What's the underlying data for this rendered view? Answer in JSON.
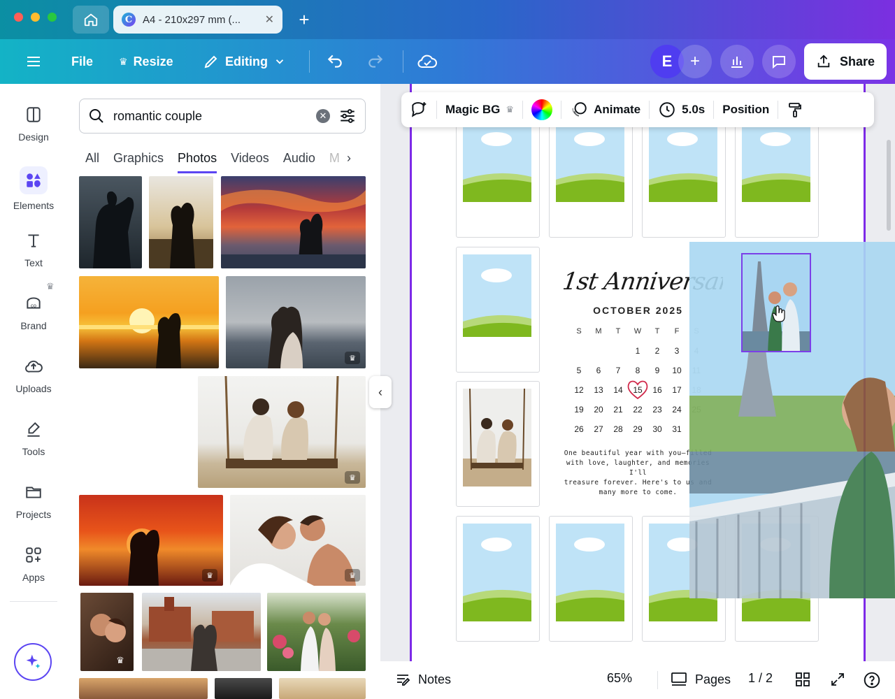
{
  "browser": {
    "tab_title": "A4 - 210x297 mm (...",
    "new_tab": "+"
  },
  "toolbar": {
    "file": "File",
    "resize": "Resize",
    "editing": "Editing",
    "avatar_initial": "E",
    "share": "Share"
  },
  "rail": {
    "items": [
      {
        "label": "Design",
        "icon": "layout-icon"
      },
      {
        "label": "Elements",
        "icon": "shapes-icon"
      },
      {
        "label": "Text",
        "icon": "text-icon"
      },
      {
        "label": "Brand",
        "icon": "brand-icon"
      },
      {
        "label": "Uploads",
        "icon": "cloud-upload-icon"
      },
      {
        "label": "Tools",
        "icon": "pen-icon"
      },
      {
        "label": "Projects",
        "icon": "folder-icon"
      },
      {
        "label": "Apps",
        "icon": "apps-icon"
      }
    ]
  },
  "panel": {
    "search_value": "romantic couple",
    "tabs": [
      "All",
      "Graphics",
      "Photos",
      "Videos",
      "Audio",
      "M"
    ],
    "active_tab": "Photos"
  },
  "context": {
    "magic_bg": "Magic BG",
    "animate": "Animate",
    "duration": "5.0s",
    "position": "Position"
  },
  "calendar": {
    "heading_script": "1st Anniversary",
    "month": "OCTOBER 2025",
    "dow": [
      "S",
      "M",
      "T",
      "W",
      "T",
      "F",
      "S"
    ],
    "days": [
      "",
      "",
      "",
      "1",
      "2",
      "3",
      "4",
      "5",
      "6",
      "7",
      "8",
      "9",
      "10",
      "11",
      "12",
      "13",
      "14",
      "15",
      "16",
      "17",
      "18",
      "19",
      "20",
      "21",
      "22",
      "23",
      "24",
      "25",
      "26",
      "27",
      "28",
      "29",
      "30",
      "31",
      ""
    ],
    "highlight": "15",
    "message_lines": [
      "One beautiful year with you—filled",
      "with love, laughter, and memories I'll",
      "treasure forever. Here's to us and",
      "many more to come."
    ]
  },
  "bottom": {
    "notes": "Notes",
    "zoom": "65%",
    "pages": "Pages",
    "page_indicator": "1 / 2"
  },
  "colors": {
    "accent": "#7d2ae8",
    "brand": "#5b45f2",
    "sky": "#bfe3f7",
    "grass": "#7fb81f"
  }
}
